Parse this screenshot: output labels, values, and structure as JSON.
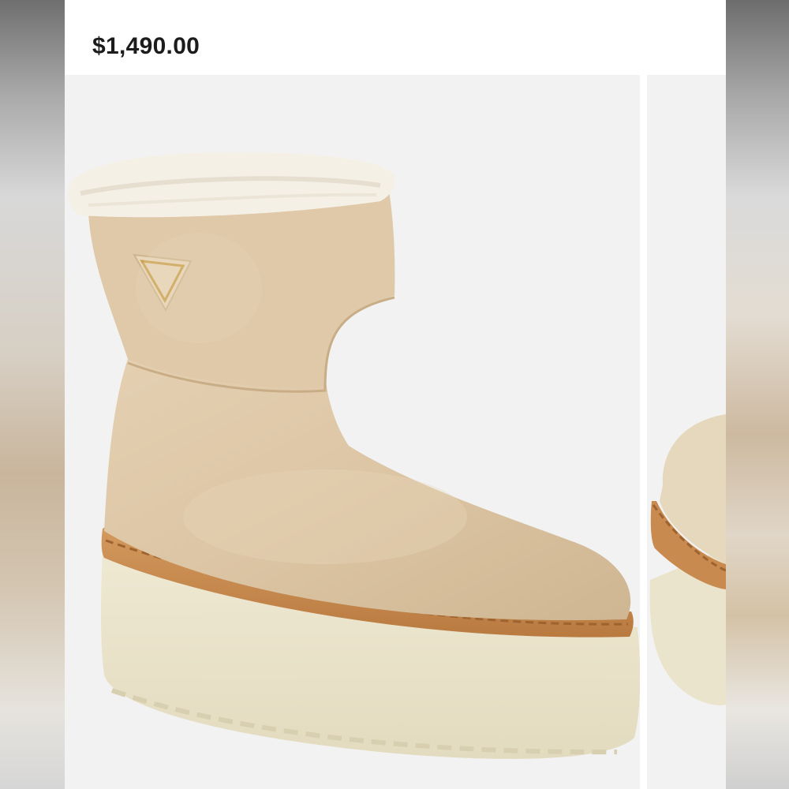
{
  "product": {
    "price": "$1,490.00"
  },
  "gallery": {
    "main_image": {
      "icon": "boot-photo",
      "colors": {
        "suede": "#dcc6a6",
        "shearling": "#f4efe4",
        "welt": "#c88a4e",
        "sole": "#ebe4cc"
      }
    },
    "next_image": {
      "icon": "boot-photo-partial"
    }
  }
}
